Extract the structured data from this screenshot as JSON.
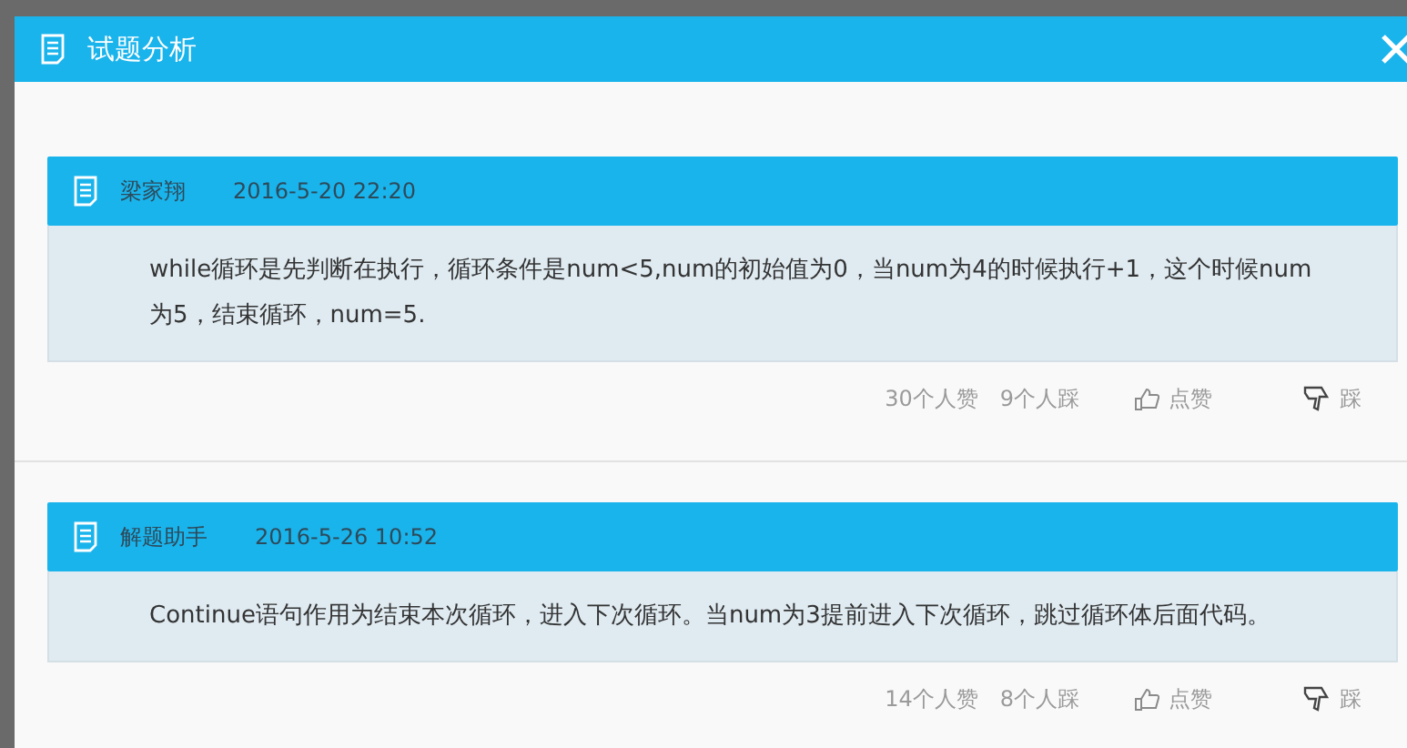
{
  "dialog": {
    "title": "试题分析"
  },
  "comments": [
    {
      "author": "梁家翔",
      "time": "2016-5-20 22:20",
      "text": "while循环是先判断在执行，循环条件是num<5,num的初始值为0，当num为4的时候执行+1，这个时候num为5，结束循环，num=5.",
      "likes": "30个人赞",
      "dislikes": "9个人踩",
      "like_label": "点赞",
      "dislike_label": "踩"
    },
    {
      "author": "解题助手",
      "time": "2016-5-26 10:52",
      "text": "Continue语句作用为结束本次循环，进入下次循环。当num为3提前进入下次循环，跳过循环体后面代码。",
      "likes": "14个人赞",
      "dislikes": "8个人踩",
      "like_label": "点赞",
      "dislike_label": "踩"
    }
  ]
}
